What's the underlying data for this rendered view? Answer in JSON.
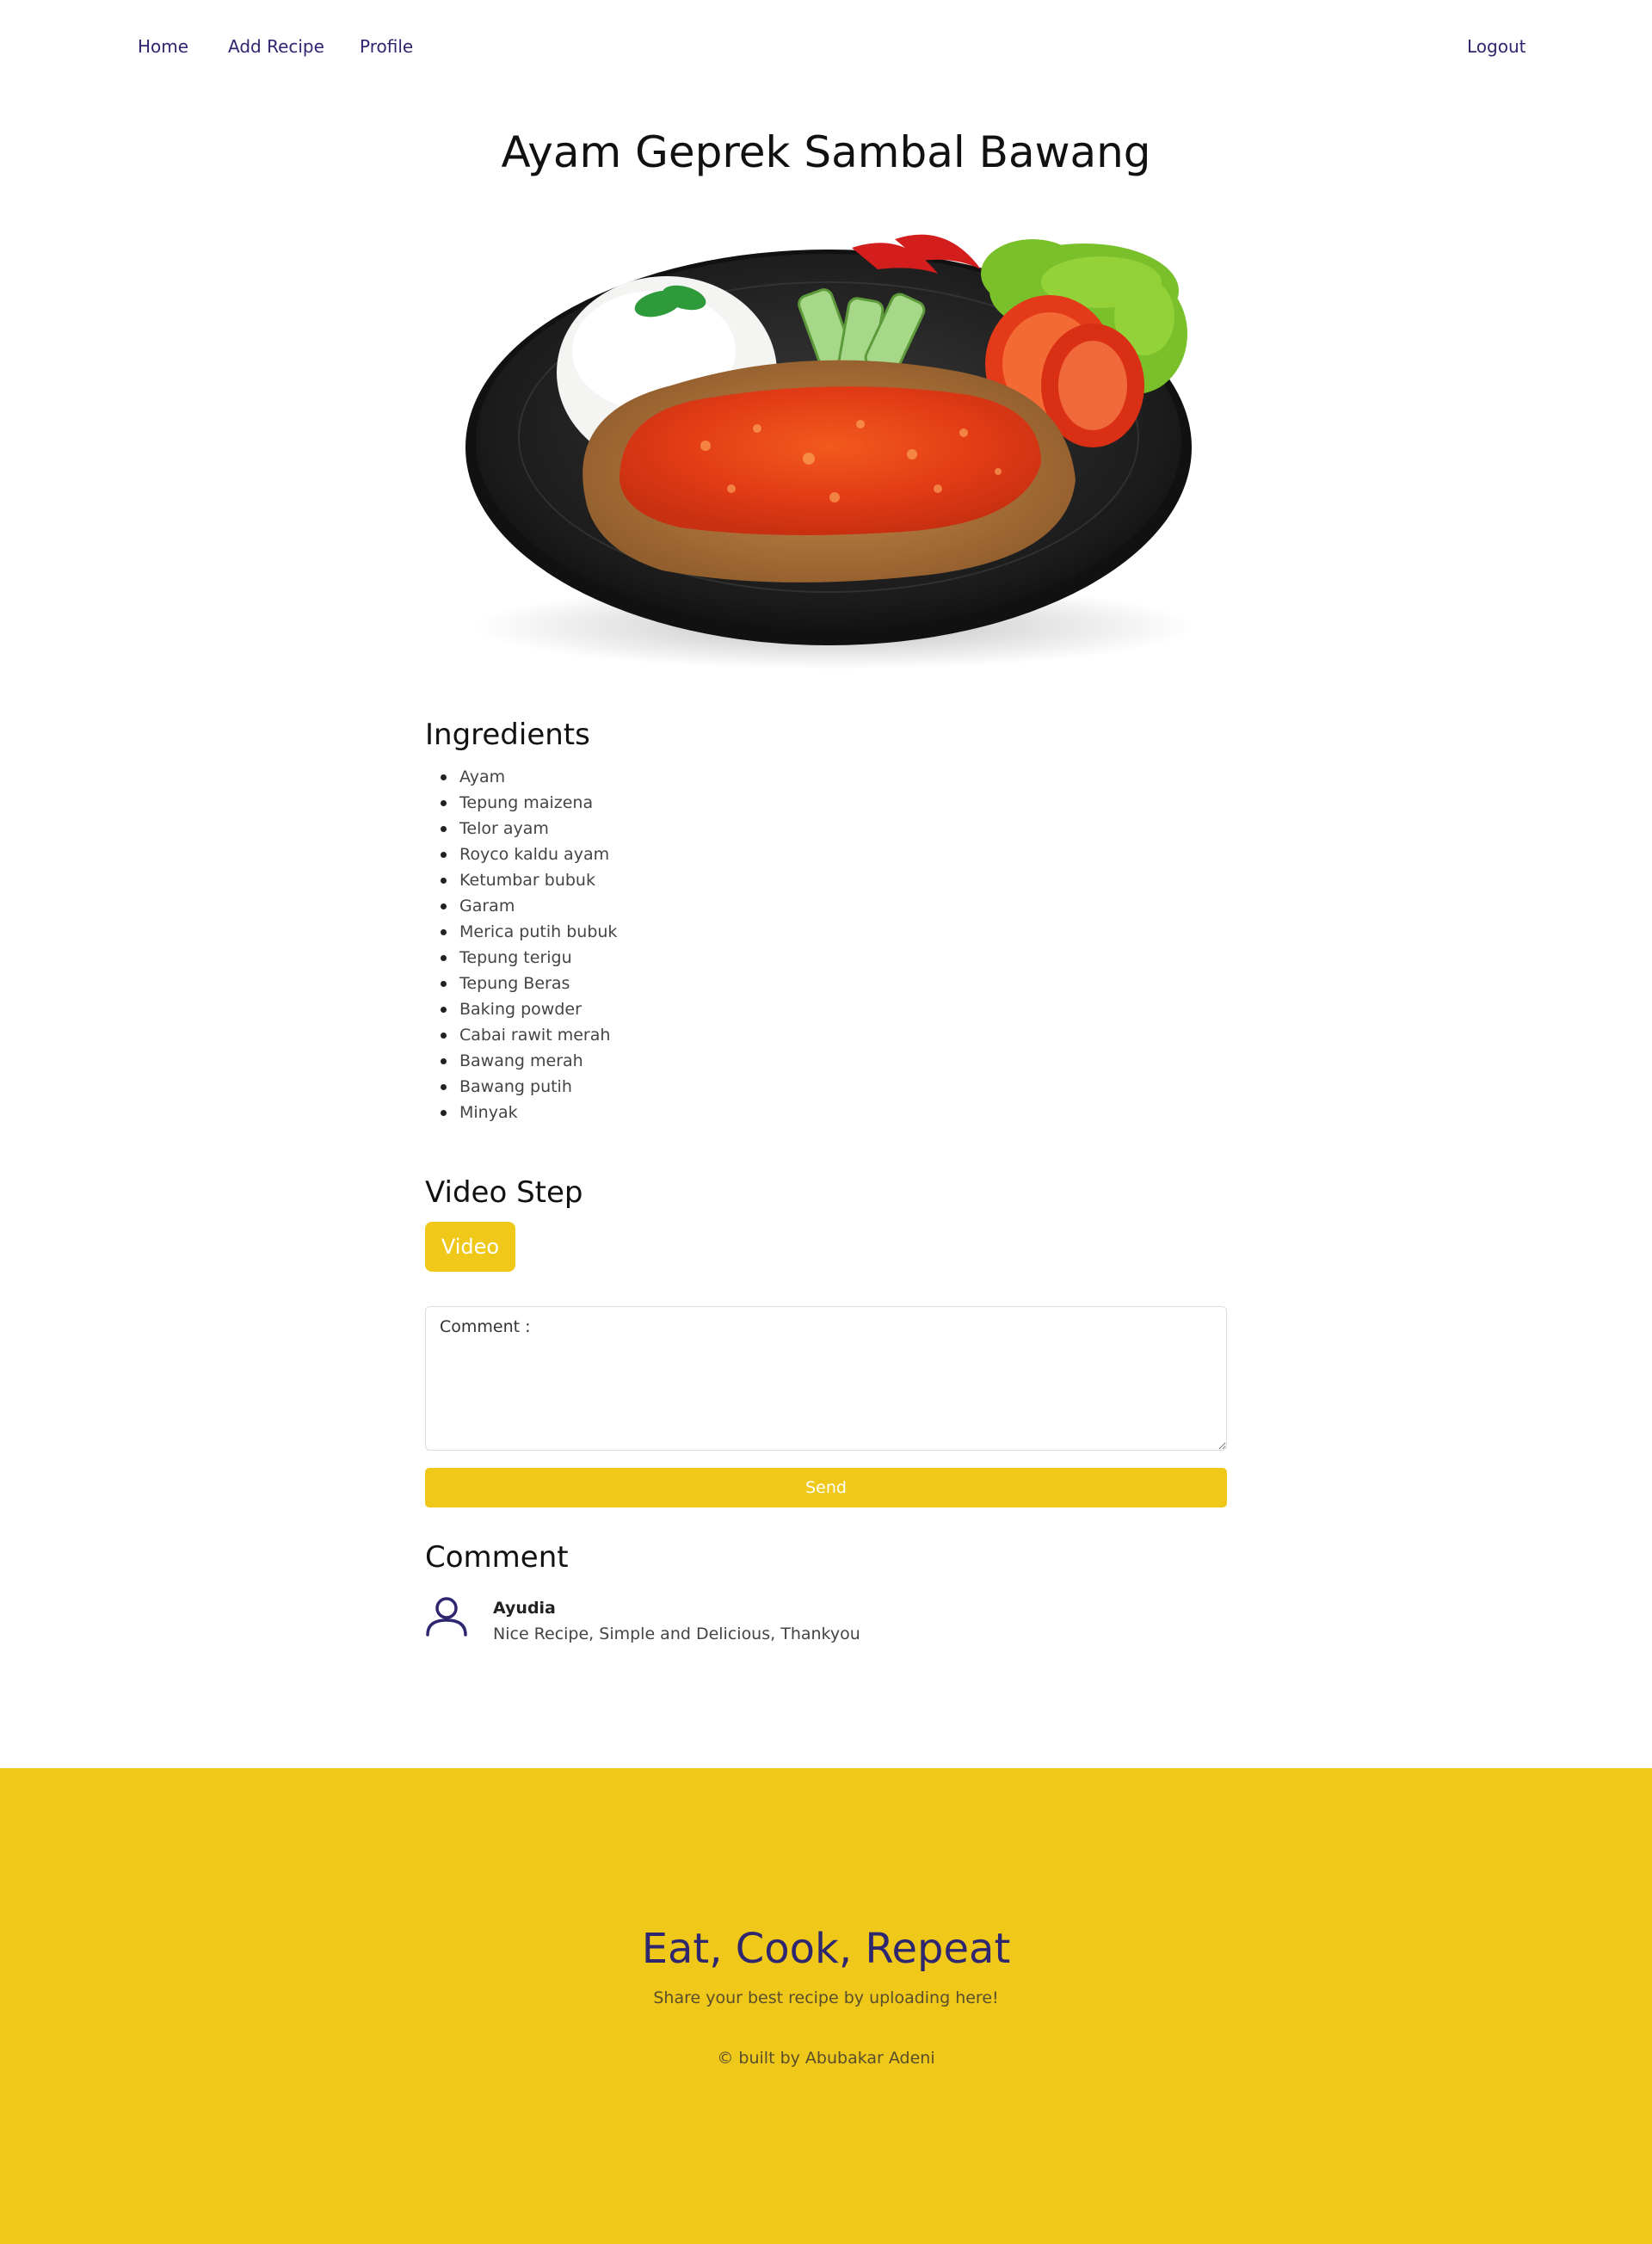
{
  "nav": {
    "home": "Home",
    "add_recipe": "Add Recipe",
    "profile": "Profile",
    "logout": "Logout"
  },
  "recipe": {
    "title": "Ayam Geprek Sambal Bawang"
  },
  "ingredients": {
    "heading": "Ingredients",
    "items": [
      "Ayam",
      "Tepung maizena",
      "Telor ayam",
      "Royco kaldu ayam",
      "Ketumbar bubuk",
      "Garam",
      "Merica putih bubuk",
      "Tepung terigu",
      "Tepung Beras",
      "Baking powder",
      "Cabai rawit merah",
      "Bawang merah",
      "Bawang putih",
      "Minyak"
    ]
  },
  "video_step": {
    "heading": "Video Step",
    "button_label": "Video"
  },
  "comment_form": {
    "placeholder": "Comment :",
    "send_label": "Send"
  },
  "comments": {
    "heading": "Comment",
    "items": [
      {
        "author": "Ayudia",
        "text": "Nice Recipe, Simple and Delicious, Thankyou"
      }
    ]
  },
  "footer": {
    "title": "Eat, Cook, Repeat",
    "subtitle": "Share your best recipe by uploading here!",
    "copyright": "© built by Abubakar Adeni"
  },
  "colors": {
    "accent": "#efc81a",
    "nav_text": "#2e266f"
  },
  "icons": {
    "avatar": "user-icon"
  }
}
